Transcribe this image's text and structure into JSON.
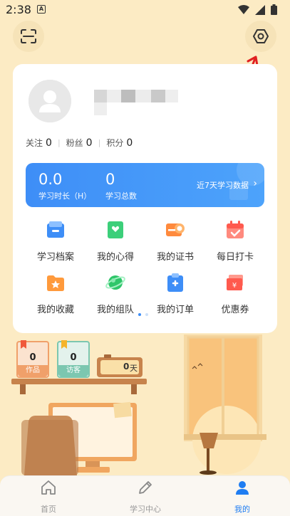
{
  "status_bar": {
    "time": "2:38",
    "notification_letter": "A"
  },
  "header": {
    "scan_icon": "scan-icon",
    "settings_icon": "hexagon-settings-icon"
  },
  "profile": {
    "follow_label": "关注",
    "follow_count": "0",
    "fans_label": "粉丝",
    "fans_count": "0",
    "points_label": "积分",
    "points_count": "0"
  },
  "study": {
    "duration_value": "0.0",
    "duration_label": "学习时长（H）",
    "total_value": "0",
    "total_label": "学习总数",
    "recent_link": "近7天学习数据"
  },
  "menu": [
    {
      "label": "学习档案",
      "icon": "archive-icon",
      "color": "#3e8ef7"
    },
    {
      "label": "我的心得",
      "icon": "notes-icon",
      "color": "#3ccf7a"
    },
    {
      "label": "我的证书",
      "icon": "certificate-icon",
      "color": "#ff8a3d"
    },
    {
      "label": "每日打卡",
      "icon": "calendar-check-icon",
      "color": "#ff5a4e"
    },
    {
      "label": "我的收藏",
      "icon": "favorites-folder-icon",
      "color": "#ff9a3c"
    },
    {
      "label": "我的组队",
      "icon": "team-planet-icon",
      "color": "#2fc66a"
    },
    {
      "label": "我的订单",
      "icon": "order-clipboard-icon",
      "color": "#3e8ef7"
    },
    {
      "label": "优惠券",
      "icon": "coupon-icon",
      "color": "#ff5a4e"
    }
  ],
  "scene": {
    "works_count": "0",
    "works_label": "作品",
    "visitors_count": "0",
    "visitors_label": "访客",
    "days_count": "0",
    "days_unit": "天"
  },
  "nav": [
    {
      "label": "首页",
      "icon": "home-icon"
    },
    {
      "label": "学习中心",
      "icon": "pencil-icon"
    },
    {
      "label": "我的",
      "icon": "profile-icon"
    }
  ]
}
